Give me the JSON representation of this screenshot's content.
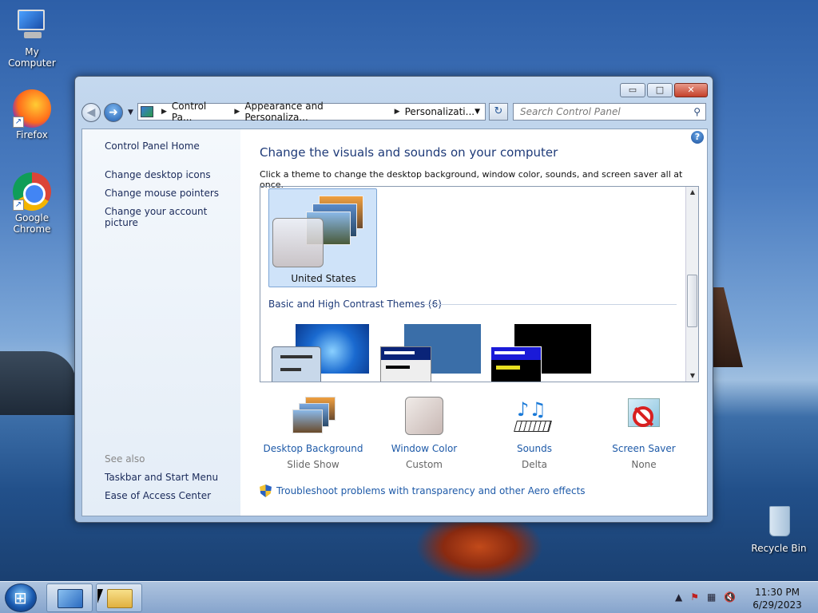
{
  "desktop": {
    "icons": [
      {
        "label": "My Computer"
      },
      {
        "label": "Firefox"
      },
      {
        "label": "Google Chrome"
      },
      {
        "label": "Recycle Bin"
      }
    ]
  },
  "window": {
    "controls": {
      "minimize": "▭",
      "maximize": "□",
      "close": "✕"
    },
    "nav": {
      "back": "◀",
      "forward": "➜",
      "dropdown": "▼"
    },
    "breadcrumb": [
      "Control Pa...",
      "Appearance and Personaliza...",
      "Personalizati..."
    ],
    "breadcrumb_sep": "▶",
    "address_dropdown": "▼",
    "refresh": "↻",
    "search": {
      "placeholder": "Search Control Panel",
      "icon": "search-icon"
    },
    "help": "?"
  },
  "left_pane": {
    "home": "Control Panel Home",
    "links": [
      "Change desktop icons",
      "Change mouse pointers",
      "Change your account picture"
    ],
    "see_also_title": "See also",
    "see_also": [
      "Taskbar and Start Menu",
      "Ease of Access Center"
    ]
  },
  "main": {
    "title": "Change the visuals and sounds on your computer",
    "description": "Click a theme to change the desktop background, window color, sounds, and screen saver all at once.",
    "selected_theme": "United States",
    "group_header": "Basic and High Contrast Themes (6)"
  },
  "tools": [
    {
      "name": "Desktop Background",
      "value": "Slide Show"
    },
    {
      "name": "Window Color",
      "value": "Custom"
    },
    {
      "name": "Sounds",
      "value": "Delta"
    },
    {
      "name": "Screen Saver",
      "value": "None"
    }
  ],
  "troubleshoot": "Troubleshoot problems with transparency and other Aero effects",
  "taskbar": {
    "tray_arrow": "▲",
    "time": "11:30 PM",
    "date": "6/29/2023"
  },
  "colors": {
    "link": "#1e5aa8",
    "title": "#1e3a78",
    "selected_theme_bg": "#cfe3f9"
  }
}
